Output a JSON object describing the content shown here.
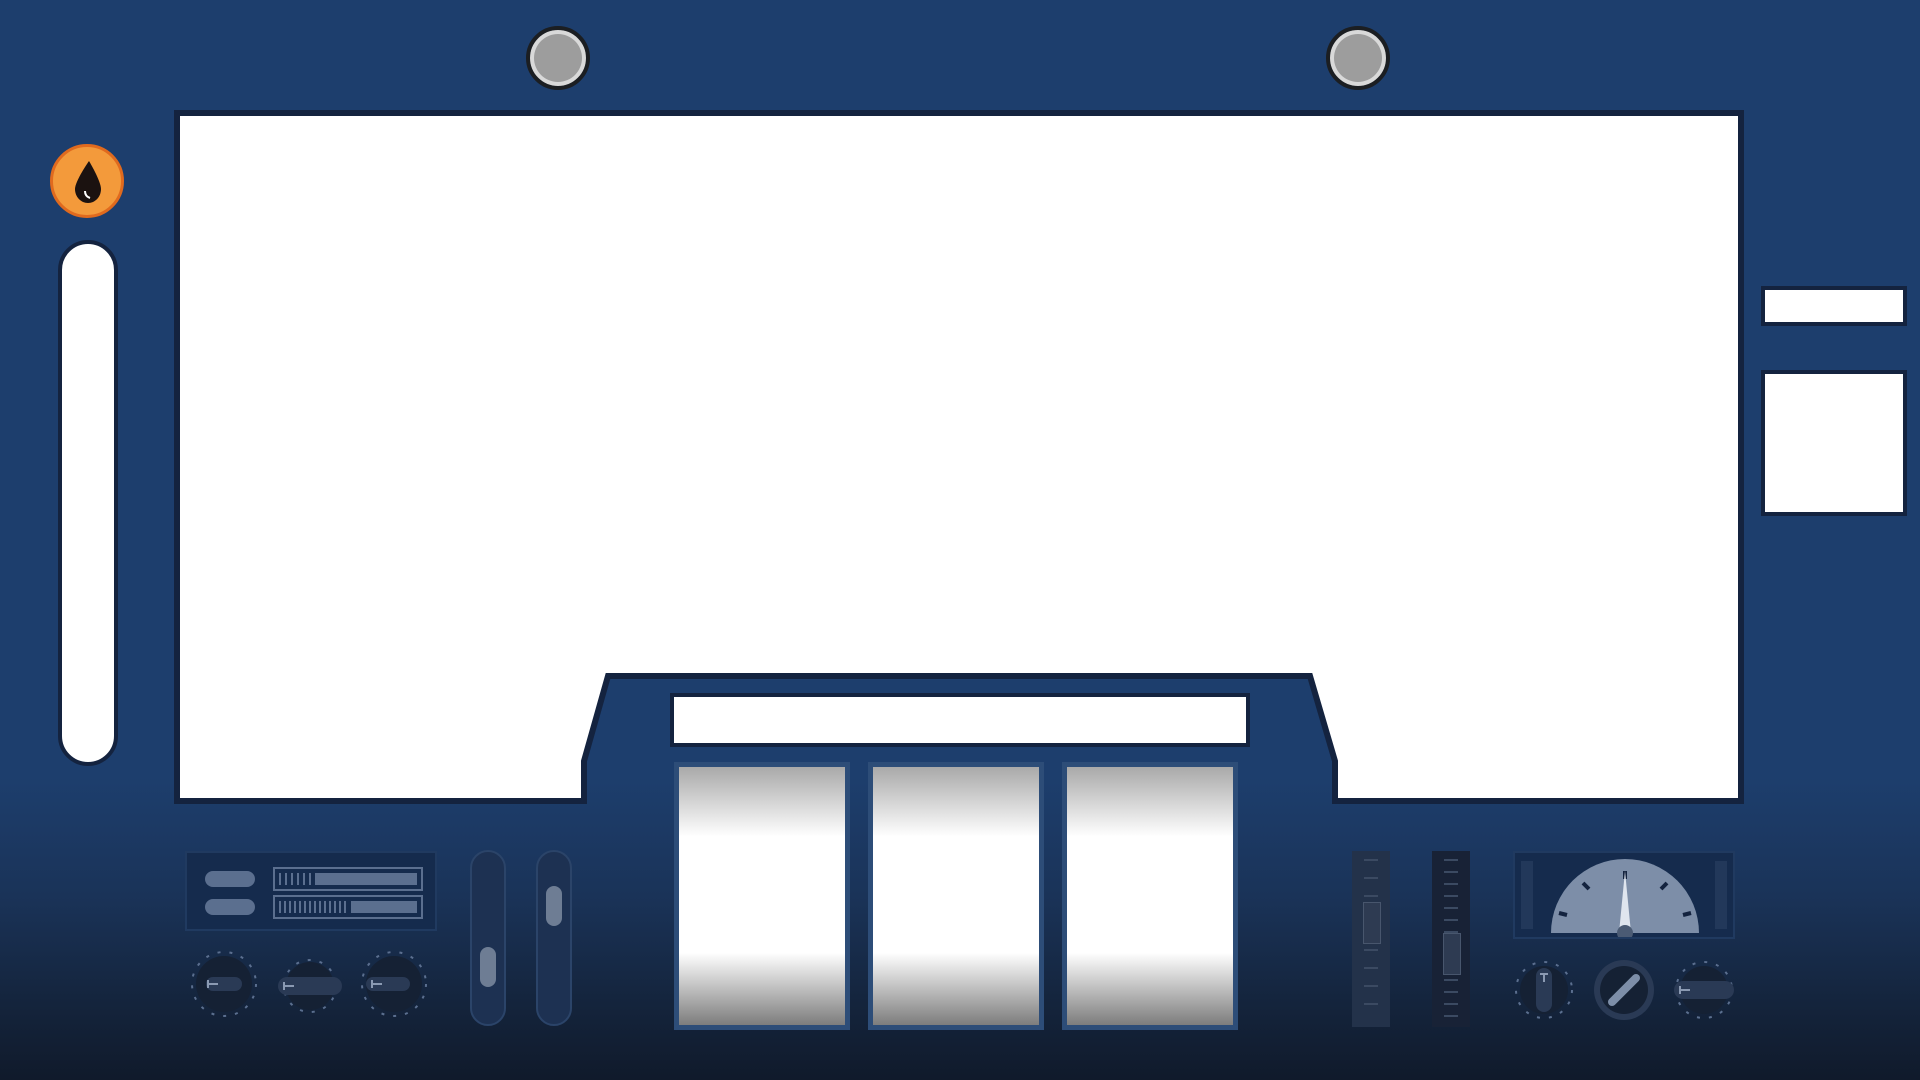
{
  "game": {
    "title": "",
    "reels": [
      {
        "symbol": ""
      },
      {
        "symbol": ""
      },
      {
        "symbol": ""
      }
    ],
    "message_display": "",
    "info_panels": {
      "top_right": "",
      "side_right": ""
    },
    "oil_meter": {
      "icon": "oil-drop-icon",
      "level": 0
    },
    "bolts": [
      "bolt-left",
      "bolt-right"
    ]
  },
  "controls": {
    "left_sliders": [
      {
        "level": 0.25
      },
      {
        "level": 0.78
      }
    ],
    "right_faders": [
      {
        "level": 0.64
      },
      {
        "level": 0.38
      }
    ],
    "gauge": {
      "needle_value": 0.5
    }
  },
  "colors": {
    "background": "#1d3e6d",
    "screen": "#ffffff",
    "outline": "#14233f",
    "oil_button": "#f39a3b",
    "panel": "#152b4d"
  }
}
